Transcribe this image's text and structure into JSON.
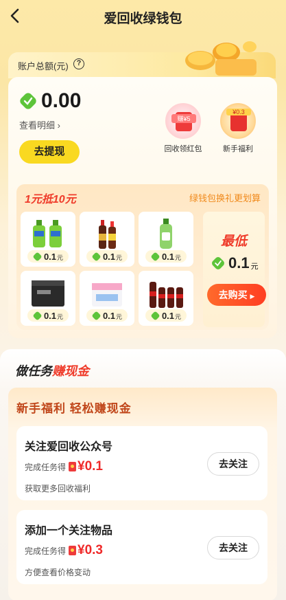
{
  "header": {
    "title": "爱回收绿钱包"
  },
  "account": {
    "total_label": "账户总额(元)",
    "help_symbol": "?",
    "balance": "0.00",
    "detail_link": "查看明细",
    "withdraw_button": "去提现"
  },
  "bonuses": [
    {
      "badge": "赚¥5",
      "label": "回收领红包"
    },
    {
      "badge": "¥0.3",
      "label": "新手福利"
    }
  ],
  "shop": {
    "title": "1元抵10元",
    "link": "绿钱包换礼更划算",
    "products": [
      {
        "price": "0.1",
        "unit": "元",
        "icon": "hand-soap-bottles"
      },
      {
        "price": "0.1",
        "unit": "元",
        "icon": "soy-sauce-bottles"
      },
      {
        "price": "0.1",
        "unit": "元",
        "icon": "dish-soap-bottle"
      },
      {
        "price": "0.1",
        "unit": "元",
        "icon": "tissue-box"
      },
      {
        "price": "0.1",
        "unit": "元",
        "icon": "paper-towel-pack"
      },
      {
        "price": "0.1",
        "unit": "元",
        "icon": "cola-bottles"
      }
    ],
    "lowest_label": "最低",
    "lowest_price": "0.1",
    "lowest_unit": "元",
    "buy_button": "去购买"
  },
  "tasks": {
    "section_title_a": "做任务",
    "section_title_b": "赚现金",
    "box_title": "新手福利 轻松赚现金",
    "items": [
      {
        "name": "关注爱回收公众号",
        "reward_prefix": "完成任务得",
        "amount": "¥0.1",
        "desc": "获取更多回收福利",
        "button": "去关注"
      },
      {
        "name": "添加一个关注物品",
        "reward_prefix": "完成任务得",
        "amount": "¥0.3",
        "desc": "方便查看价格变动",
        "button": "去关注"
      }
    ]
  },
  "colors": {
    "accent_yellow": "#f9d921",
    "accent_red": "#ef3b2a",
    "green_gem": "#5dc43a"
  }
}
